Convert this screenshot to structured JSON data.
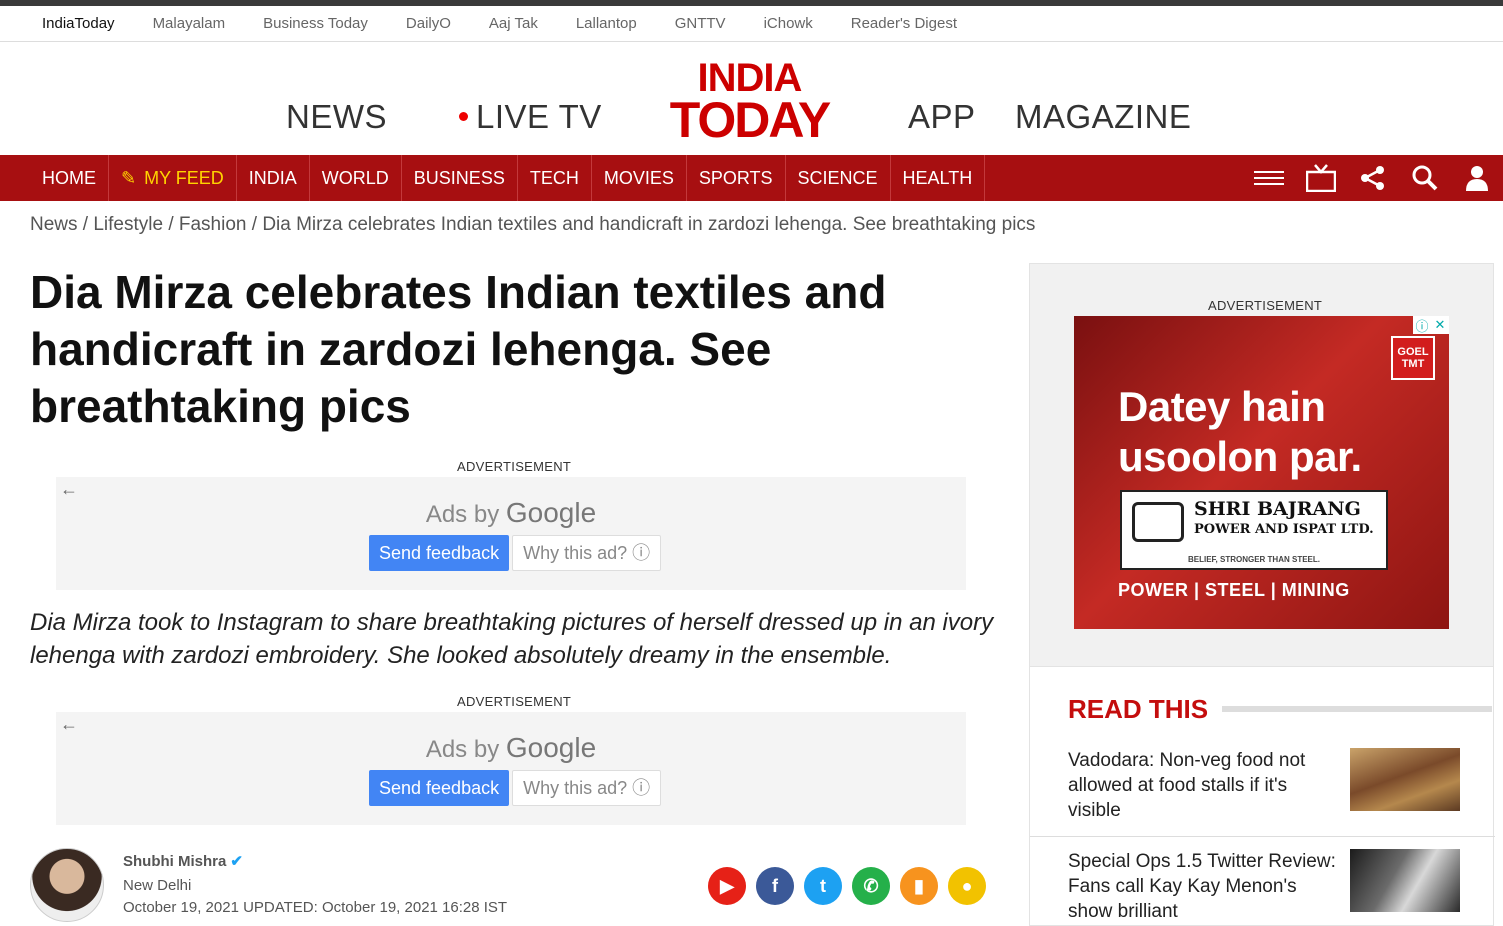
{
  "network_bar": [
    "IndiaToday",
    "Malayalam",
    "Business Today",
    "DailyO",
    "Aaj Tak",
    "Lallantop",
    "GNTTV",
    "iChowk",
    "Reader's Digest"
  ],
  "masthead": {
    "news": "NEWS",
    "live_tv": "LIVE TV",
    "logo_line1": "INDIA",
    "logo_line2": "TODAY",
    "app": "APP",
    "magazine": "MAGAZINE"
  },
  "nav": {
    "items": [
      "HOME",
      "MY FEED",
      "INDIA",
      "WORLD",
      "BUSINESS",
      "TECH",
      "MOVIES",
      "SPORTS",
      "SCIENCE",
      "HEALTH"
    ],
    "feed_icon": "pencil-icon",
    "right_icons": [
      "menu-icon",
      "tv-icon",
      "share-icon",
      "search-icon",
      "user-icon"
    ]
  },
  "breadcrumb": "News / Lifestyle / Fashion / Dia Mirza celebrates Indian textiles and handicraft in zardozi lehenga. See breathtaking pics",
  "article": {
    "headline": "Dia Mirza celebrates Indian textiles and handicraft in zardozi lehenga. See breathtaking pics",
    "summary": "Dia Mirza took to Instagram to share breathtaking pictures of herself dressed up in an ivory lehenga with zardozi embroidery. She looked absolutely dreamy in the ensemble.",
    "author": "Shubhi Mishra",
    "location": "New Delhi",
    "date": "October 19, 2021  UPDATED: October 19, 2021 16:28 IST"
  },
  "ads": {
    "label": "ADVERTISEMENT",
    "ads_by": "Ads by",
    "google": "Google",
    "send_feedback": "Send feedback",
    "why_this_ad": "Why this ad? ⓘ"
  },
  "share_icons": [
    {
      "name": "youtube-icon",
      "glyph": "▶",
      "color": "#e62117"
    },
    {
      "name": "facebook-icon",
      "glyph": "f",
      "color": "#3b5998"
    },
    {
      "name": "twitter-icon",
      "glyph": "t",
      "color": "#1da1f2"
    },
    {
      "name": "whatsapp-icon",
      "glyph": "✆",
      "color": "#25b04a"
    },
    {
      "name": "bookmark-icon",
      "glyph": "▮",
      "color": "#f7931e"
    },
    {
      "name": "comment-icon",
      "glyph": "●",
      "color": "#f2c200"
    }
  ],
  "sidebar_ad": {
    "label": "ADVERTISEMENT",
    "brand_badge": "GOEL TMT",
    "headline_line1": "Datey hain",
    "headline_line2": "usoolon par.",
    "company_line1": "SHRI BAJRANG",
    "company_line2": "POWER AND ISPAT LTD.",
    "company_tagline": "BELIEF, STRONGER THAN STEEL.",
    "footer": "POWER | STEEL | MINING"
  },
  "read_this": {
    "title": "READ THIS",
    "items": [
      "Vadodara: Non-veg food not allowed at food stalls if it's visible",
      "Special Ops 1.5 Twitter Review: Fans call Kay Kay Menon's show brilliant"
    ]
  }
}
